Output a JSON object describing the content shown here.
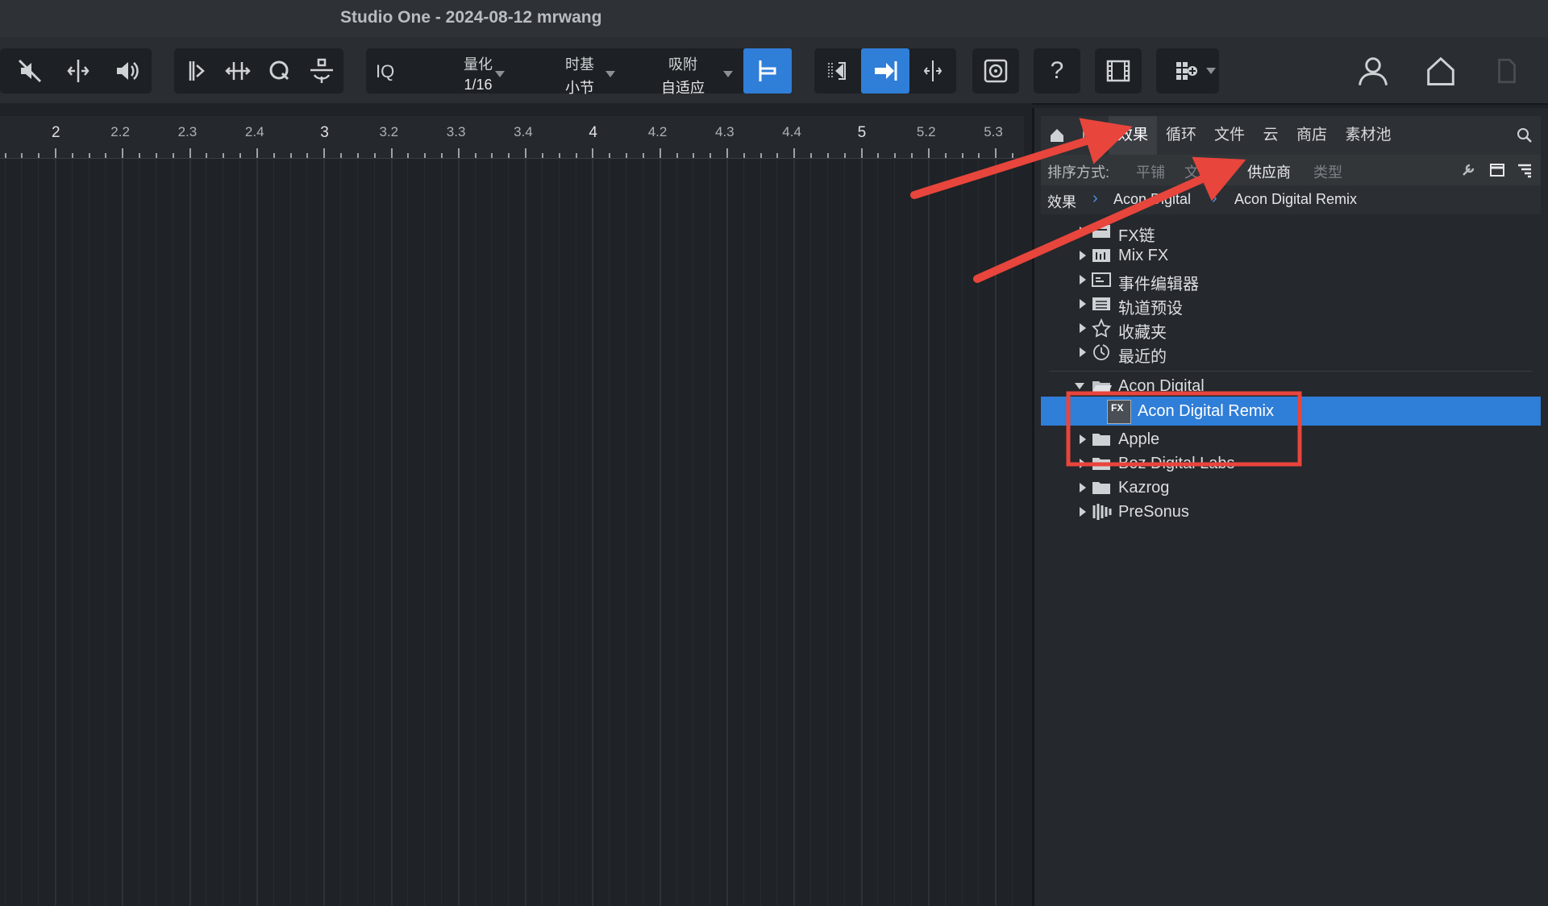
{
  "window": {
    "title": "Studio One - 2024-08-12 mrwang"
  },
  "toolbar": {
    "iq_label": "IQ",
    "quantize": {
      "label": "量化",
      "value": "1/16"
    },
    "timebase": {
      "label": "时基",
      "value": "小节"
    },
    "snap": {
      "label": "吸附",
      "value": "自适应"
    },
    "help_label": "?"
  },
  "ruler": {
    "labels": [
      "2",
      "2.2",
      "2.3",
      "2.4",
      "3",
      "3.2",
      "3.3",
      "3.4",
      "4",
      "4.2",
      "4.3",
      "4.4",
      "5",
      "5.2",
      "5.3"
    ]
  },
  "browser": {
    "tabs": [
      "效果",
      "循环",
      "文件",
      "云",
      "商店",
      "素材池"
    ],
    "active_tab": "效果",
    "sort": {
      "label": "排序方式:",
      "options": [
        "平铺",
        "文件夹",
        "供应商",
        "类型"
      ],
      "active": "供应商"
    },
    "breadcrumb": [
      "效果",
      "Acon Digital",
      "Acon Digital Remix"
    ],
    "tree": [
      {
        "label": "FX链",
        "icon": "fx-chain-icon"
      },
      {
        "label": "Mix FX",
        "icon": "mixfx-icon"
      },
      {
        "label": "事件编辑器",
        "icon": "event-editor-icon"
      },
      {
        "label": "轨道预设",
        "icon": "track-preset-icon"
      },
      {
        "label": "收藏夹",
        "icon": "star-icon"
      },
      {
        "label": "最近的",
        "icon": "clock-icon"
      },
      {
        "label": "Acon Digital",
        "icon": "folder-open-icon"
      },
      {
        "label": "Acon Digital Remix",
        "icon": "fx-plugin-icon",
        "selected": true
      },
      {
        "label": "Apple",
        "icon": "folder-icon"
      },
      {
        "label": "Boz Digital Labs",
        "icon": "folder-icon"
      },
      {
        "label": "Kazrog",
        "icon": "folder-icon"
      },
      {
        "label": "PreSonus",
        "icon": "presonus-icon"
      }
    ],
    "plugin_badge": "FX"
  },
  "colors": {
    "accent": "#2f7ed8",
    "annotation": "#e8453c",
    "background": "#1f2226"
  }
}
